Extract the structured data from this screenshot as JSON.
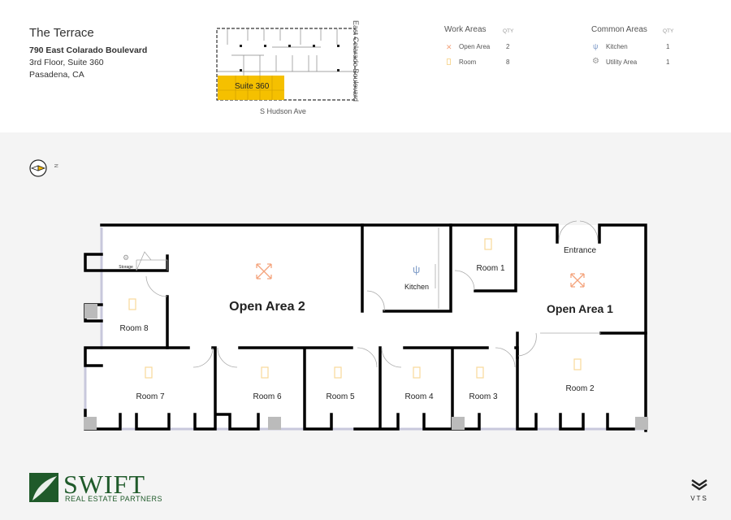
{
  "property": {
    "name": "The Terrace",
    "address": "790 East Colarado Boulevard",
    "suite": "3rd Floor, Suite 360",
    "city": "Pasadena, CA"
  },
  "keymap": {
    "suite_label": "Suite 360",
    "street_bottom": "S Hudson Ave",
    "street_right": "East Colarado Boulevard",
    "highlight_color": "#f5c000"
  },
  "legend": {
    "work": {
      "title": "Work Areas",
      "qty_header": "QTY",
      "items": [
        {
          "label": "Open Area",
          "qty": "2",
          "icon": "expand-arrows-icon"
        },
        {
          "label": "Room",
          "qty": "8",
          "icon": "door-icon"
        }
      ]
    },
    "common": {
      "title": "Common Areas",
      "qty_header": "QTY",
      "items": [
        {
          "label": "Kitchen",
          "qty": "1",
          "icon": "fork-spoon-icon"
        },
        {
          "label": "Utility Area",
          "qty": "1",
          "icon": "gear-icon"
        }
      ]
    }
  },
  "compass": {
    "label": "N"
  },
  "plan": {
    "rooms": {
      "open2": "Open Area 2",
      "open1": "Open Area 1",
      "kitchen": "Kitchen",
      "storage": "Storage",
      "entrance": "Entrance",
      "r1": "Room 1",
      "r2": "Room 2",
      "r3": "Room 3",
      "r4": "Room 4",
      "r5": "Room 5",
      "r6": "Room 6",
      "r7": "Room 7",
      "r8": "Room 8"
    },
    "colors": {
      "open_icon": "#f4a37c",
      "room_icon": "#f8d99a",
      "kitchen_icon": "#7f9cc8",
      "wall": "#000000",
      "column": "#bbbbbb"
    }
  },
  "branding": {
    "logo_text": "SWIFT",
    "logo_sub": "REAL ESTATE PARTNERS",
    "vts": "VTS"
  }
}
